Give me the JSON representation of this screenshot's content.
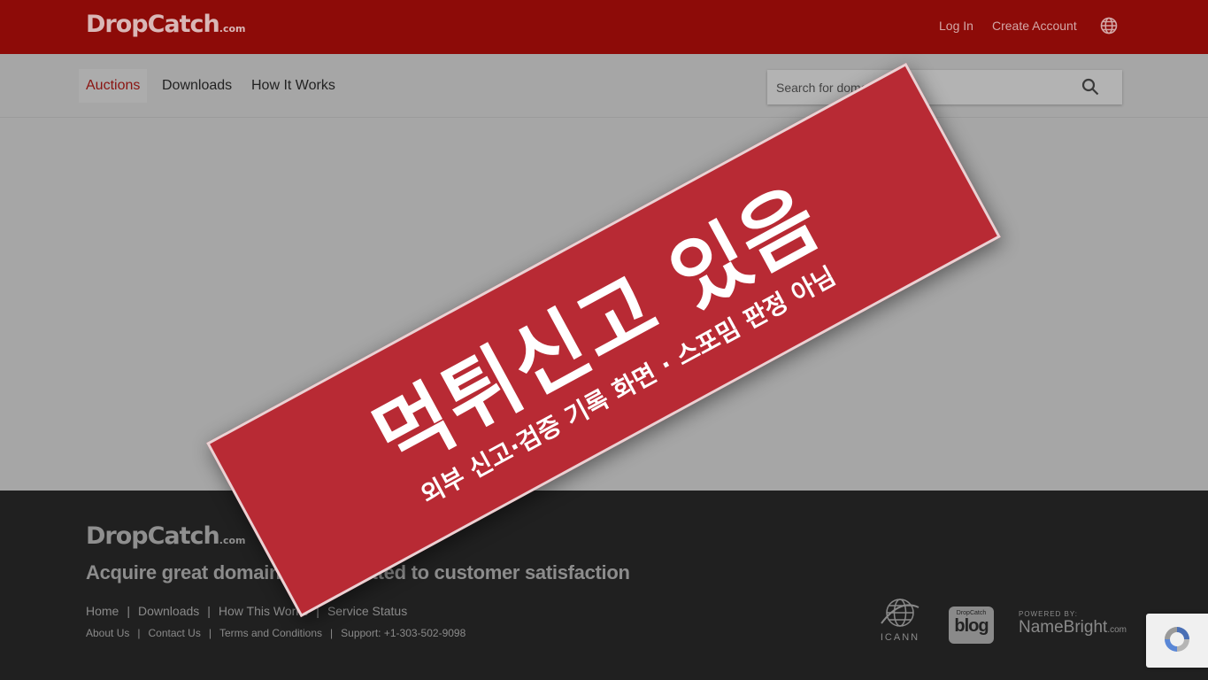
{
  "header": {
    "logo_text": "DropCatch",
    "logo_suffix": ".com",
    "login_label": "Log In",
    "create_account_label": "Create Account",
    "language_icon": "globe-icon"
  },
  "nav": {
    "items": [
      "Auctions",
      "Downloads",
      "How It Works"
    ],
    "active": "Auctions",
    "search_placeholder": "Search for domains",
    "search_icon": "search-icon"
  },
  "banner": {
    "main_text": "먹튀신고 있음",
    "sub_text": "외부 신고·검증 기록 화면 · 스포밈 판정 아님"
  },
  "footer": {
    "logo_text": "DropCatch",
    "logo_suffix": ".com",
    "tagline": "Acquire great domains | Committed to customer satisfaction",
    "primary_links": [
      "Home",
      "Downloads",
      "How This Works",
      "Service Status"
    ],
    "secondary_links": [
      "About Us",
      "Contact Us",
      "Terms and Conditions",
      "Support: +1-303-502-9098"
    ],
    "separator": "|",
    "partners": {
      "icann": "ICANN",
      "blog_small": "DropCatch",
      "blog_big": "blog",
      "namebright_powered": "POWERED BY:",
      "namebright_name": "NameBright",
      "namebright_suffix": ".com"
    }
  },
  "colors": {
    "header_bg": "#8d0b08",
    "banner_bg": "#b82a34",
    "footer_bg": "#202020",
    "overlay_page": "#a6a6a6"
  }
}
